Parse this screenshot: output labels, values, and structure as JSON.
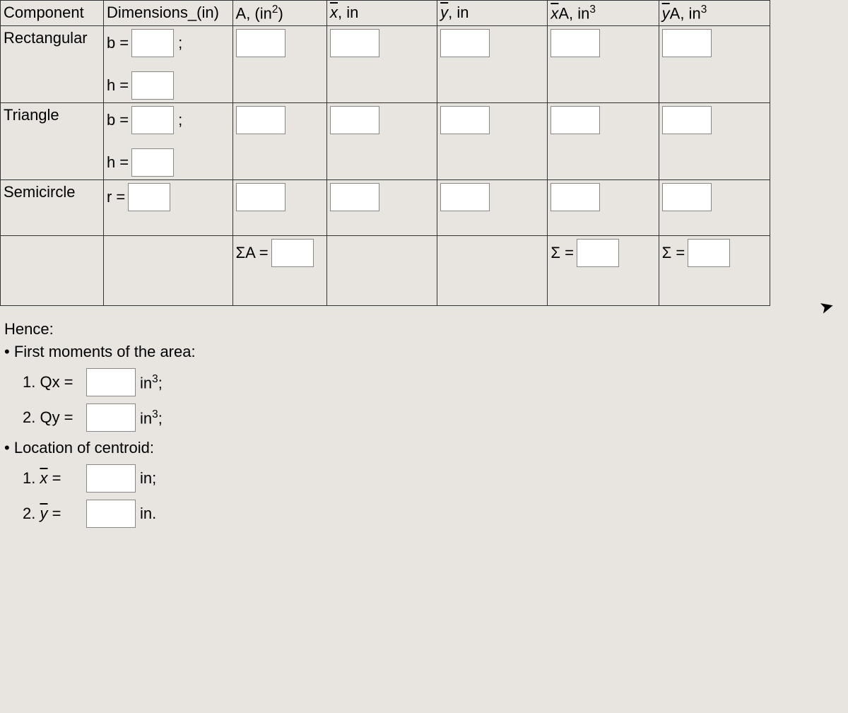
{
  "table": {
    "headers": {
      "component": "Component",
      "dimensions": "Dimensions_(in)",
      "area": "A, (in²)",
      "xbar": "x̄, in",
      "ybar": "ȳ, in",
      "xA": "x̄A, in³",
      "yA": "ȳA, in³"
    },
    "rows": {
      "rectangular": {
        "name": "Rectangular",
        "dim_b": "b =",
        "dim_h": "h ="
      },
      "triangle": {
        "name": "Triangle",
        "dim_b": "b =",
        "dim_h": "h ="
      },
      "semicircle": {
        "name": "Semicircle",
        "dim_r": "r ="
      },
      "sum": {
        "sigmaA": "ΣA =",
        "sigma_xA": "Σ =",
        "sigma_yA": "Σ ="
      }
    }
  },
  "below": {
    "hence": "Hence:",
    "first_moments": "First moments of the area:",
    "qx_label": "1. Qx =",
    "qx_unit": "in³;",
    "qy_label": "2. Qy =",
    "qy_unit": "in³;",
    "location": "Location of centroid:",
    "xbar_label": "1. x̄ =",
    "xbar_unit": "in;",
    "ybar_label": "2. ȳ =",
    "ybar_unit": "in."
  },
  "semicolon": ";"
}
